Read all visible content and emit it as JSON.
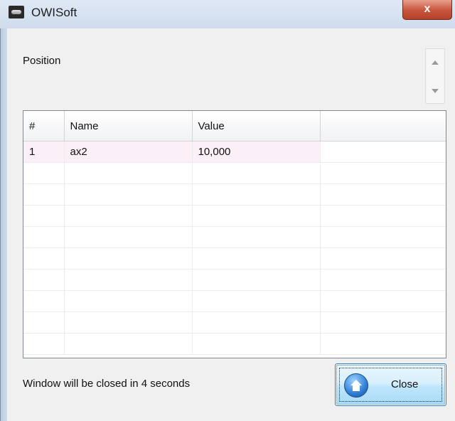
{
  "window": {
    "title": "OWISoft",
    "close_glyph": "x"
  },
  "section": {
    "label": "Position"
  },
  "grid": {
    "columns": [
      "#",
      "Name",
      "Value",
      ""
    ],
    "rows": [
      [
        "1",
        "ax2",
        "10,000",
        ""
      ]
    ]
  },
  "status": {
    "message": "Window will be closed in 4 seconds"
  },
  "close_button": {
    "label": "Close",
    "icon": "home-icon"
  },
  "colors": {
    "selected_row": "#fbf0f8",
    "button_border": "#3c7fb1",
    "titlebar": "#dfe9f5"
  }
}
